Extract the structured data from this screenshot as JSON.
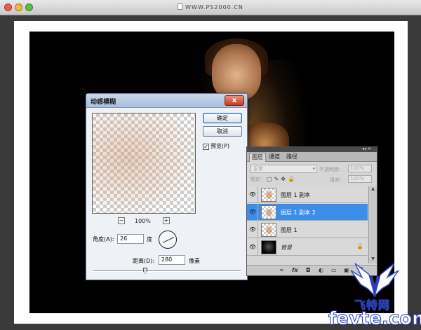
{
  "mac_window": {
    "title": "WWW.PS2000.CN"
  },
  "dialog": {
    "title": "动感模糊",
    "close_label": "x",
    "ok_label": "确定",
    "cancel_label": "取消",
    "preview_label": "预览(P)",
    "preview_checked": true,
    "zoom_minus": "−",
    "zoom_plus": "+",
    "zoom_value": "100%",
    "angle_label": "角度(A):",
    "angle_value": "26",
    "angle_unit": "度",
    "distance_label": "距离(D):",
    "distance_value": "280",
    "distance_unit": "像素"
  },
  "layers_panel": {
    "tabs": [
      "图层",
      "通道",
      "路径"
    ],
    "blend_mode": "正常",
    "opacity_label": "不透明度:",
    "opacity_value": "100%",
    "lock_label": "锁定:",
    "fill_label": "填充:",
    "fill_value": "100%",
    "layers": [
      {
        "name": "图层 1 副本",
        "selected": false,
        "thumb": "transparent-face"
      },
      {
        "name": "图层 1 副本 2",
        "selected": true,
        "thumb": "transparent-face"
      },
      {
        "name": "图层 1",
        "selected": false,
        "thumb": "transparent-face"
      },
      {
        "name": "背景",
        "selected": false,
        "thumb": "black",
        "locked": true
      }
    ],
    "bottom_icons": [
      "link-icon",
      "fx-icon",
      "mask-icon",
      "adjustment-icon",
      "group-icon",
      "new-layer-icon",
      "trash-icon"
    ]
  },
  "watermark": {
    "cn": "飞特网",
    "en": "fevte.com"
  },
  "colors": {
    "selection": "#3d8ee8",
    "watermark_blue": "#1f36c8"
  }
}
